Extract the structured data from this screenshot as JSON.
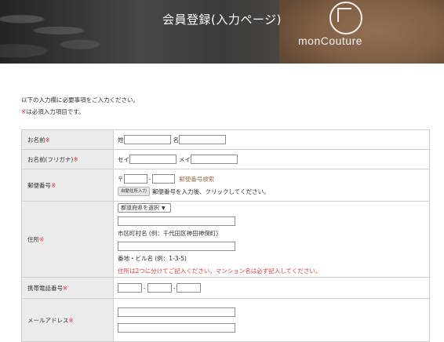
{
  "header": {
    "title": "会員登録(入力ページ)",
    "logo_text": "monCouture"
  },
  "intro": {
    "line1": "以下の入力欄に必要事項をご入力ください。",
    "required_mark": "※",
    "line2": "は必須入力項目です。"
  },
  "form": {
    "name": {
      "label": "お名前",
      "required": "※",
      "last_label": "姓",
      "last_value": "",
      "first_label": "名",
      "first_value": ""
    },
    "kana": {
      "label": "お名前(フリガナ)",
      "required": "※",
      "last_label": "セイ",
      "last_value": "",
      "first_label": "メイ",
      "first_value": ""
    },
    "zip": {
      "label": "郵便番号",
      "required": "※",
      "prefix": "〒",
      "separator": "-",
      "part1": "",
      "part2": "",
      "lookup_link": "郵便番号検索",
      "auto_button": "自動住所入力",
      "hint": "郵便番号を入力後、クリックしてください。"
    },
    "address": {
      "label": "住所",
      "required": "※",
      "prefecture_selected": "都道府県を選択",
      "city_label": "市区町村名 (例：千代田区神田神保町)",
      "street_label": "番地・ビル名 (例：1-3-5)",
      "note": "住所は2つに分けてご記入ください。マンション名は必ず記入してください。"
    },
    "tel": {
      "label": "携帯電話番号",
      "required": "※",
      "separator": "-"
    },
    "email": {
      "label": "メールアドレス",
      "required": "※"
    }
  },
  "colors": {
    "required_red": "#e5393b",
    "link_brown": "#a0784e",
    "label_bg": "#ececec",
    "border": "#cfcfcf"
  }
}
